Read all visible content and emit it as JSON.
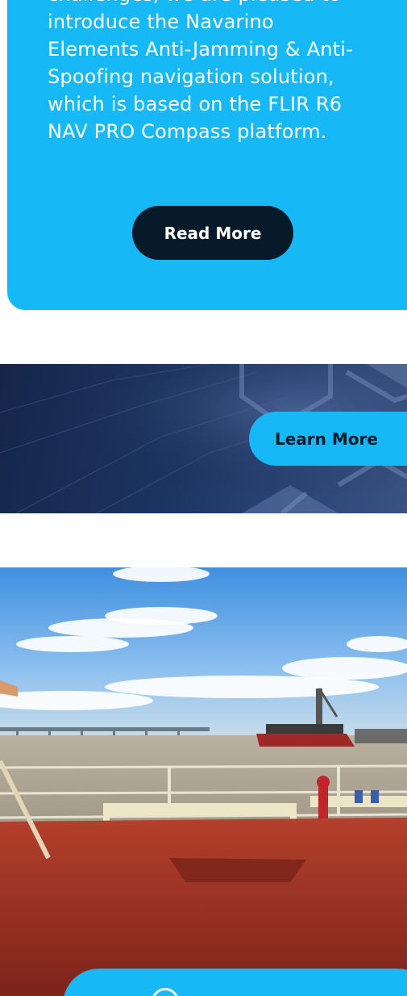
{
  "promo": {
    "text_lines": [
      "challenges, we are pleased to",
      "introduce  the Navarino",
      "Elements Anti-Jamming & Anti-",
      "Spoofing navigation solution,",
      "which is based on the FLIR R6",
      "NAV PRO Compass platform."
    ],
    "read_more_label": "Read More"
  },
  "banner": {
    "learn_more_label": "Learn More"
  },
  "colors": {
    "accent_blue": "#16b9f6",
    "dark_navy": "#061a2a"
  }
}
